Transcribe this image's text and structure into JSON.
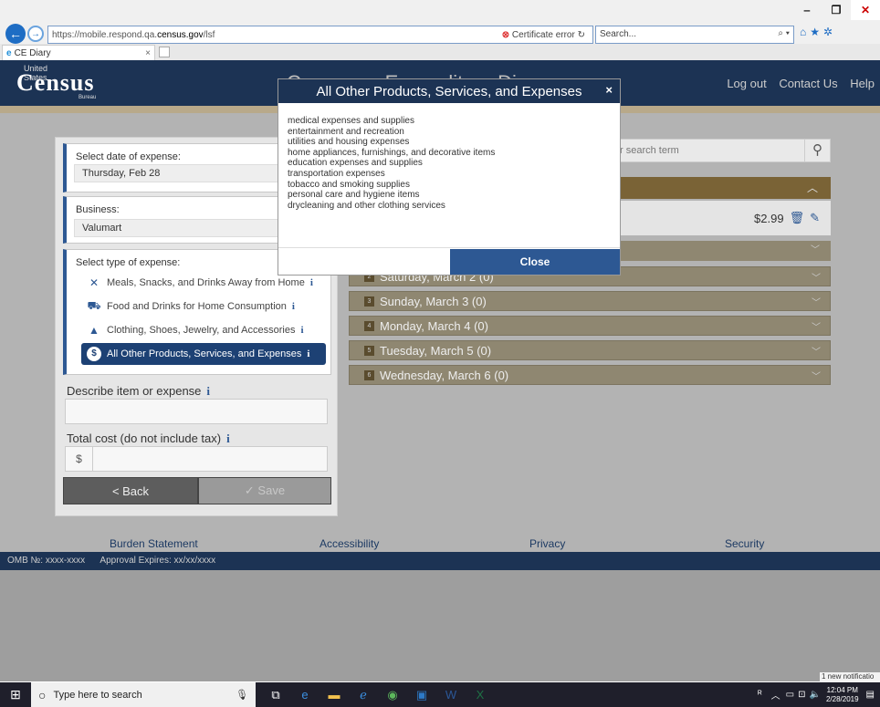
{
  "browser": {
    "url_prefix": "https://mobile.respond.qa.",
    "url_domain": "census.gov",
    "url_path": "/lsf",
    "cert_error": "Certificate error",
    "search_placeholder": "Search...",
    "tab_title": "CE Diary"
  },
  "header": {
    "logo_top": "United States",
    "logo_word": "Census",
    "logo_bottom": "Bureau",
    "title": "Consumer Expenditure Diary",
    "links": [
      "Log out",
      "Contact Us",
      "Help"
    ]
  },
  "form": {
    "date_label": "Select date of expense:",
    "date_value": "Thursday, Feb 28",
    "business_label": "Business:",
    "business_value": "Valumart",
    "type_label": "Select type of expense:",
    "types": [
      {
        "label": "Meals, Snacks, and Drinks Away from Home",
        "icon": "utensils-icon"
      },
      {
        "label": "Food and Drinks for Home Consumption",
        "icon": "cart-icon"
      },
      {
        "label": "Clothing, Shoes, Jewelry, and Accessories",
        "icon": "shirt-icon"
      },
      {
        "label": "All Other Products, Services, and Expenses",
        "icon": "dollar-icon",
        "selected": true
      }
    ],
    "info_glyph": "i",
    "describe_label": "Describe item or expense",
    "cost_label": "Total cost (do not include tax)",
    "currency_symbol": "$",
    "back_label": "< Back",
    "save_label": "✓ Save"
  },
  "diary": {
    "search_placeholder": "r search term",
    "expense_amount": "$2.99",
    "day_partial": "",
    "days": [
      {
        "label": "Saturday, March 2 (0)",
        "num": "2"
      },
      {
        "label": "Sunday, March 3 (0)",
        "num": "3"
      },
      {
        "label": "Monday, March 4 (0)",
        "num": "4"
      },
      {
        "label": "Tuesday, March 5 (0)",
        "num": "5"
      },
      {
        "label": "Wednesday, March 6 (0)",
        "num": "6"
      }
    ]
  },
  "footer": {
    "links": [
      "Burden Statement",
      "Accessibility",
      "Privacy",
      "Security"
    ],
    "omb": "OMB №: xxxx-xxxx",
    "approval": "Approval Expires: xx/xx/xxxx"
  },
  "modal": {
    "title": "All Other Products, Services, and Expenses",
    "items": [
      "medical expenses and supplies",
      "entertainment and recreation",
      "utilities and housing expenses",
      "home appliances, furnishings, and decorative items",
      "education expenses and supplies",
      "transportation expenses",
      "tobacco and smoking supplies",
      "personal care and hygiene items",
      "drycleaning and other clothing services"
    ],
    "close_label": "Close",
    "close_x": "×"
  },
  "taskbar": {
    "search_text": "Type here to search",
    "time": "12:04 PM",
    "date": "2/28/2019",
    "notification": "1 new notificatio"
  }
}
